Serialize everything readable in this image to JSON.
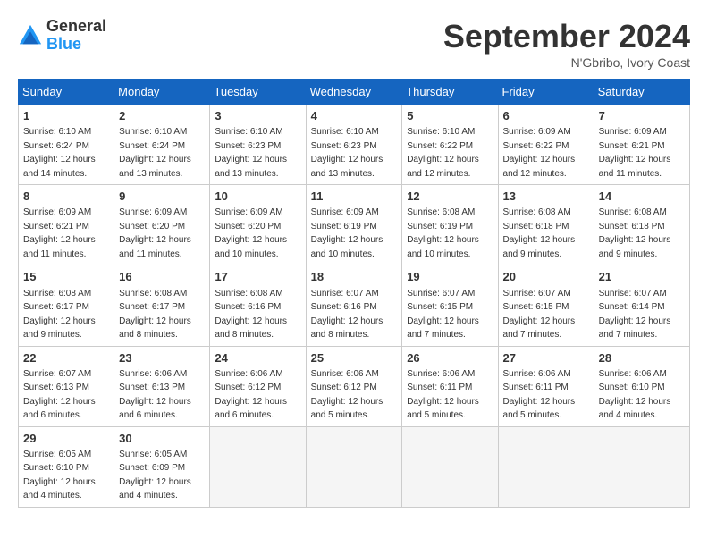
{
  "logo": {
    "general": "General",
    "blue": "Blue"
  },
  "title": "September 2024",
  "location": "N'Gbribo, Ivory Coast",
  "days_header": [
    "Sunday",
    "Monday",
    "Tuesday",
    "Wednesday",
    "Thursday",
    "Friday",
    "Saturday"
  ],
  "weeks": [
    [
      {
        "day": "1",
        "info": "Sunrise: 6:10 AM\nSunset: 6:24 PM\nDaylight: 12 hours\nand 14 minutes."
      },
      {
        "day": "2",
        "info": "Sunrise: 6:10 AM\nSunset: 6:24 PM\nDaylight: 12 hours\nand 13 minutes."
      },
      {
        "day": "3",
        "info": "Sunrise: 6:10 AM\nSunset: 6:23 PM\nDaylight: 12 hours\nand 13 minutes."
      },
      {
        "day": "4",
        "info": "Sunrise: 6:10 AM\nSunset: 6:23 PM\nDaylight: 12 hours\nand 13 minutes."
      },
      {
        "day": "5",
        "info": "Sunrise: 6:10 AM\nSunset: 6:22 PM\nDaylight: 12 hours\nand 12 minutes."
      },
      {
        "day": "6",
        "info": "Sunrise: 6:09 AM\nSunset: 6:22 PM\nDaylight: 12 hours\nand 12 minutes."
      },
      {
        "day": "7",
        "info": "Sunrise: 6:09 AM\nSunset: 6:21 PM\nDaylight: 12 hours\nand 11 minutes."
      }
    ],
    [
      {
        "day": "8",
        "info": "Sunrise: 6:09 AM\nSunset: 6:21 PM\nDaylight: 12 hours\nand 11 minutes."
      },
      {
        "day": "9",
        "info": "Sunrise: 6:09 AM\nSunset: 6:20 PM\nDaylight: 12 hours\nand 11 minutes."
      },
      {
        "day": "10",
        "info": "Sunrise: 6:09 AM\nSunset: 6:20 PM\nDaylight: 12 hours\nand 10 minutes."
      },
      {
        "day": "11",
        "info": "Sunrise: 6:09 AM\nSunset: 6:19 PM\nDaylight: 12 hours\nand 10 minutes."
      },
      {
        "day": "12",
        "info": "Sunrise: 6:08 AM\nSunset: 6:19 PM\nDaylight: 12 hours\nand 10 minutes."
      },
      {
        "day": "13",
        "info": "Sunrise: 6:08 AM\nSunset: 6:18 PM\nDaylight: 12 hours\nand 9 minutes."
      },
      {
        "day": "14",
        "info": "Sunrise: 6:08 AM\nSunset: 6:18 PM\nDaylight: 12 hours\nand 9 minutes."
      }
    ],
    [
      {
        "day": "15",
        "info": "Sunrise: 6:08 AM\nSunset: 6:17 PM\nDaylight: 12 hours\nand 9 minutes."
      },
      {
        "day": "16",
        "info": "Sunrise: 6:08 AM\nSunset: 6:17 PM\nDaylight: 12 hours\nand 8 minutes."
      },
      {
        "day": "17",
        "info": "Sunrise: 6:08 AM\nSunset: 6:16 PM\nDaylight: 12 hours\nand 8 minutes."
      },
      {
        "day": "18",
        "info": "Sunrise: 6:07 AM\nSunset: 6:16 PM\nDaylight: 12 hours\nand 8 minutes."
      },
      {
        "day": "19",
        "info": "Sunrise: 6:07 AM\nSunset: 6:15 PM\nDaylight: 12 hours\nand 7 minutes."
      },
      {
        "day": "20",
        "info": "Sunrise: 6:07 AM\nSunset: 6:15 PM\nDaylight: 12 hours\nand 7 minutes."
      },
      {
        "day": "21",
        "info": "Sunrise: 6:07 AM\nSunset: 6:14 PM\nDaylight: 12 hours\nand 7 minutes."
      }
    ],
    [
      {
        "day": "22",
        "info": "Sunrise: 6:07 AM\nSunset: 6:13 PM\nDaylight: 12 hours\nand 6 minutes."
      },
      {
        "day": "23",
        "info": "Sunrise: 6:06 AM\nSunset: 6:13 PM\nDaylight: 12 hours\nand 6 minutes."
      },
      {
        "day": "24",
        "info": "Sunrise: 6:06 AM\nSunset: 6:12 PM\nDaylight: 12 hours\nand 6 minutes."
      },
      {
        "day": "25",
        "info": "Sunrise: 6:06 AM\nSunset: 6:12 PM\nDaylight: 12 hours\nand 5 minutes."
      },
      {
        "day": "26",
        "info": "Sunrise: 6:06 AM\nSunset: 6:11 PM\nDaylight: 12 hours\nand 5 minutes."
      },
      {
        "day": "27",
        "info": "Sunrise: 6:06 AM\nSunset: 6:11 PM\nDaylight: 12 hours\nand 5 minutes."
      },
      {
        "day": "28",
        "info": "Sunrise: 6:06 AM\nSunset: 6:10 PM\nDaylight: 12 hours\nand 4 minutes."
      }
    ],
    [
      {
        "day": "29",
        "info": "Sunrise: 6:05 AM\nSunset: 6:10 PM\nDaylight: 12 hours\nand 4 minutes."
      },
      {
        "day": "30",
        "info": "Sunrise: 6:05 AM\nSunset: 6:09 PM\nDaylight: 12 hours\nand 4 minutes."
      },
      {
        "day": "",
        "info": ""
      },
      {
        "day": "",
        "info": ""
      },
      {
        "day": "",
        "info": ""
      },
      {
        "day": "",
        "info": ""
      },
      {
        "day": "",
        "info": ""
      }
    ]
  ]
}
